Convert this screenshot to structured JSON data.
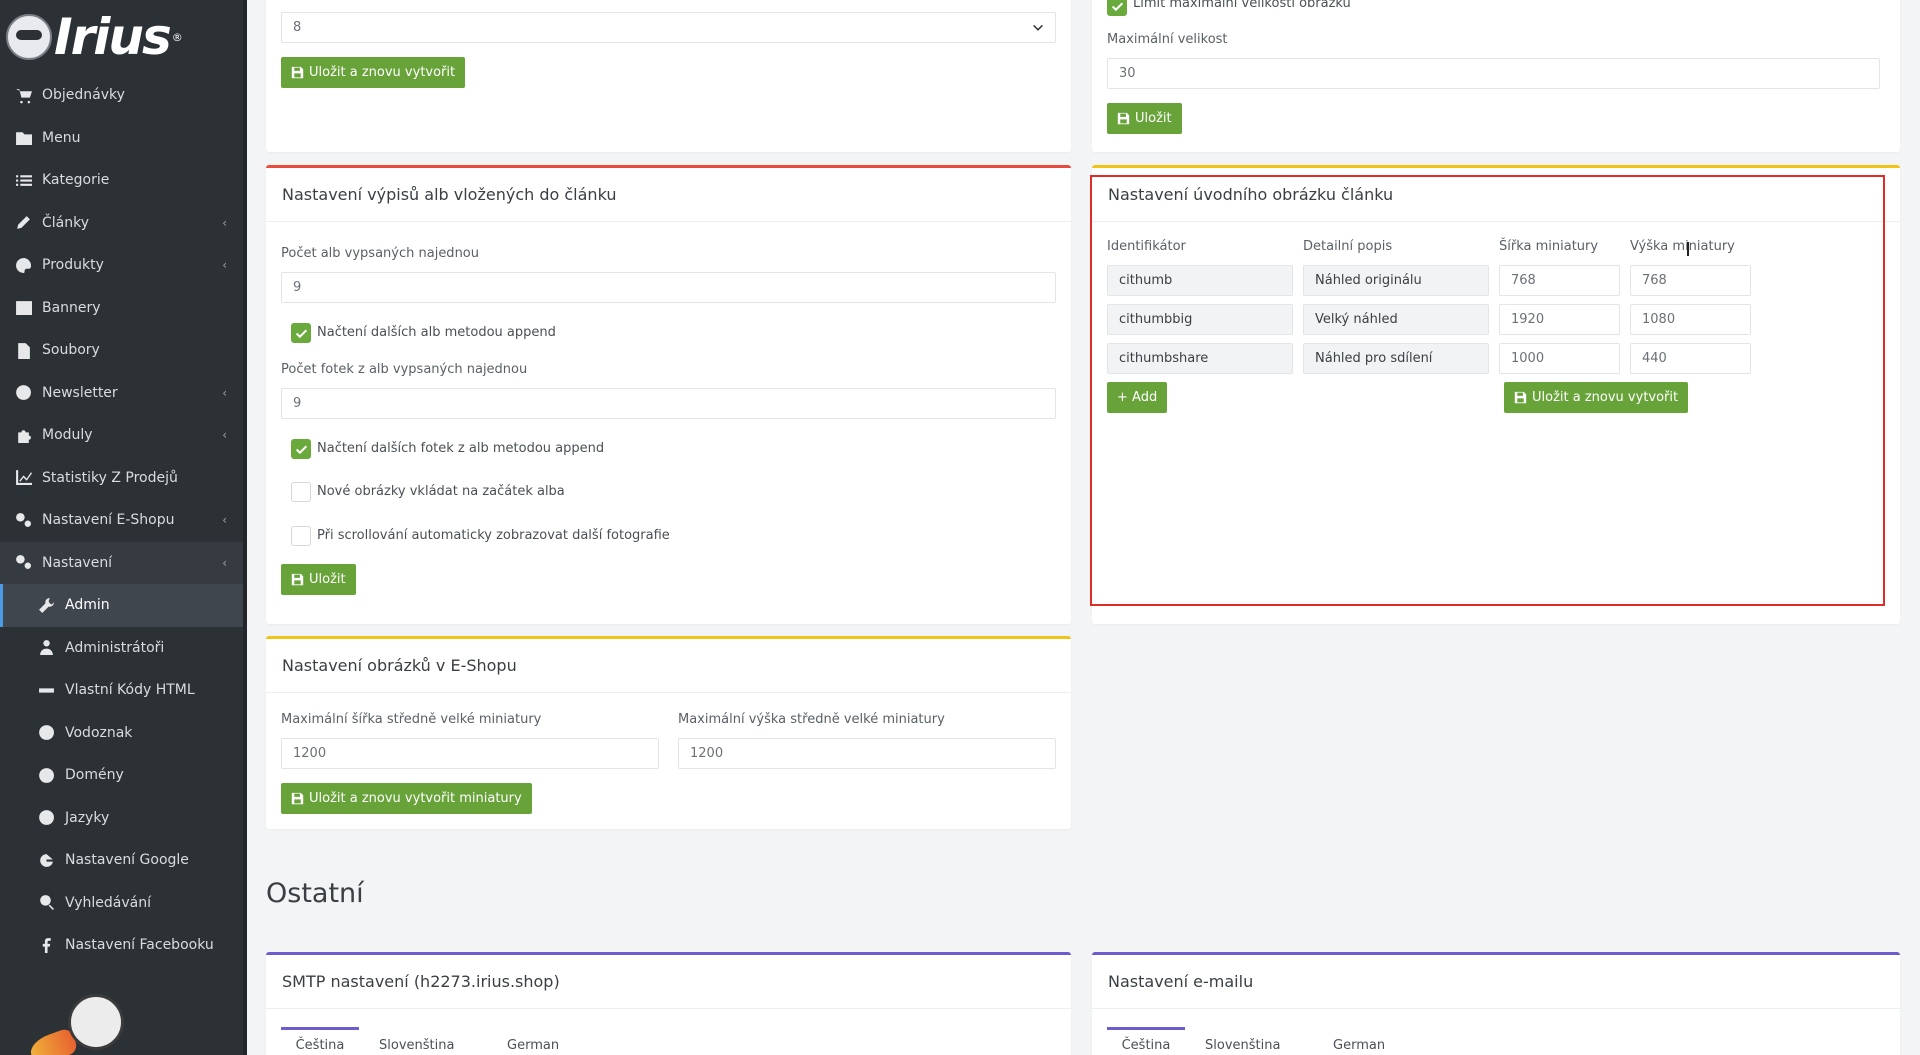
{
  "brand": {
    "name": "Irius",
    "reg": "®"
  },
  "sidebar": {
    "items": [
      {
        "label": "Objednávky",
        "icon": "cart-icon",
        "chevron": false
      },
      {
        "label": "Menu",
        "icon": "folder-icon",
        "chevron": false
      },
      {
        "label": "Kategorie",
        "icon": "list-icon",
        "chevron": false
      },
      {
        "label": "Články",
        "icon": "pencil-icon",
        "chevron": true
      },
      {
        "label": "Produkty",
        "icon": "palette-icon",
        "chevron": true
      },
      {
        "label": "Bannery",
        "icon": "image-icon",
        "chevron": false
      },
      {
        "label": "Soubory",
        "icon": "file-icon",
        "chevron": false
      },
      {
        "label": "Newsletter",
        "icon": "envelope-icon",
        "chevron": true
      },
      {
        "label": "Moduly",
        "icon": "puzzle-icon",
        "chevron": true
      },
      {
        "label": "Statistiky Z Prodejů",
        "icon": "chart-icon",
        "chevron": false
      },
      {
        "label": "Nastavení E-Shopu",
        "icon": "cogs-icon",
        "chevron": true
      },
      {
        "label": "Nastavení",
        "icon": "cogs-icon",
        "chevron": true
      }
    ],
    "subitems": [
      {
        "label": "Admin",
        "icon": "wrench-icon"
      },
      {
        "label": "Administrátoři",
        "icon": "user-icon"
      },
      {
        "label": "Vlastní Kódy HTML",
        "icon": "html-icon"
      },
      {
        "label": "Vodoznak",
        "icon": "copyright-icon"
      },
      {
        "label": "Domény",
        "icon": "globe-icon"
      },
      {
        "label": "Jazyky",
        "icon": "language-icon"
      },
      {
        "label": "Nastavení Google",
        "icon": "google-icon"
      },
      {
        "label": "Vyhledávání",
        "icon": "search-icon"
      },
      {
        "label": "Nastavení Facebooku",
        "icon": "facebook-icon"
      }
    ]
  },
  "top_left": {
    "select_value": "8",
    "save_regen": "Uložit a znovu vytvořit"
  },
  "top_right": {
    "limit_checkbox_label": "Limit maximální velikosti obrázku",
    "max_size_label": "Maximální velikost",
    "max_size_value": "30",
    "save": "Uložit"
  },
  "albums": {
    "title": "Nastavení výpisů alb vložených do článku",
    "count_label": "Počet alb vypsaných najednou",
    "count_value": "9",
    "append_albums": "Načtení dalších alb metodou append",
    "photos_label": "Počet fotek z alb vypsaných najednou",
    "photos_value": "9",
    "append_photos": "Načtení dalších fotek z alb metodou append",
    "new_at_start": "Nové obrázky vkládat na začátek alba",
    "autoload": "Při scrollování automaticky zobrazovat další fotografie",
    "save": "Uložit"
  },
  "thumbs": {
    "title": "Nastavení úvodního obrázku článku",
    "headers": [
      "Identifikátor",
      "Detailní popis",
      "Šířka miniatury",
      "Výška miniatury"
    ],
    "rows": [
      {
        "id": "cithumb",
        "desc": "Náhled originálu",
        "w": "768",
        "h": "768"
      },
      {
        "id": "cithumbbig",
        "desc": "Velký náhled",
        "w": "1920",
        "h": "1080"
      },
      {
        "id": "cithumbshare",
        "desc": "Náhled pro sdílení",
        "w": "1000",
        "h": "440"
      }
    ],
    "add": "+ Add",
    "save_regen": "Uložit a znovu vytvořit"
  },
  "eshop": {
    "title": "Nastavení obrázků v E-Shopu",
    "max_w_label": "Maximální šířka středně velké miniatury",
    "max_w_value": "1200",
    "max_h_label": "Maximální výška středně velké miniatury",
    "max_h_value": "1200",
    "save_regen": "Uložit a znovu vytvořit miniatury"
  },
  "other": {
    "heading": "Ostatní",
    "smtp_title": "SMTP nastavení (h2273.irius.shop)",
    "email_title": "Nastavení e-mailu",
    "tabs": [
      "Čeština",
      "Slovenština",
      "German"
    ]
  },
  "colors": {
    "accent_green": "#68a33a",
    "red_border": "#e74c3c",
    "yellow_border": "#f2c418",
    "purple_border": "#6c5ccf",
    "highlight": "#e02b27"
  }
}
